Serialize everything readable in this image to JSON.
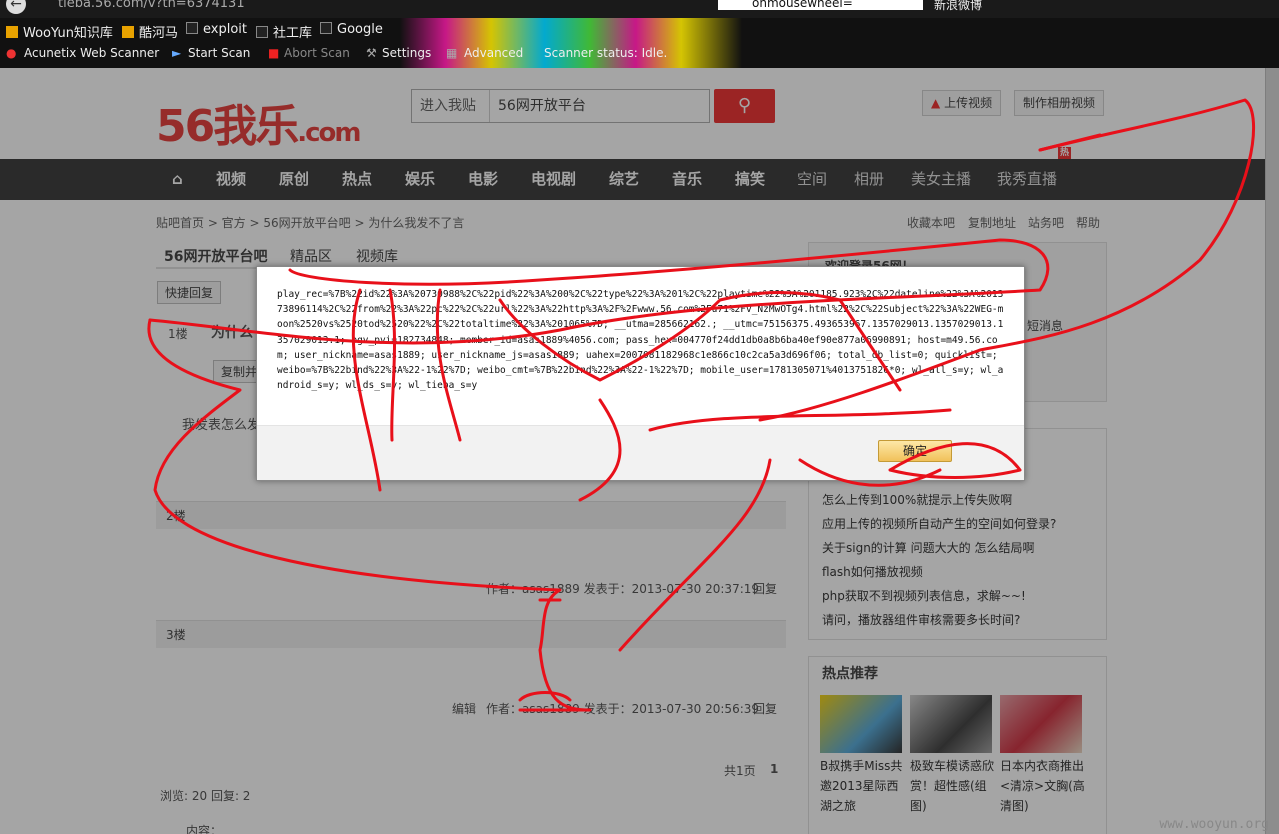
{
  "browser": {
    "url": "tieba.56.com/v?th=6374131",
    "search_value": "onmousewheel=",
    "weibo_label": "新浪微博",
    "bookmarks": [
      "WooYun知识库",
      "酷河马",
      "exploit",
      "社工库",
      "Google"
    ],
    "toolbar": {
      "acunetix": "Acunetix Web Scanner",
      "start_scan": "Start Scan",
      "abort_scan": "Abort Scan",
      "settings": "Settings",
      "advanced": "Advanced",
      "status": "Scanner status: Idle."
    }
  },
  "header": {
    "logo_num": "56",
    "logo_text": "我乐",
    "logo_domain": ".com",
    "search_select": "进入我贴",
    "search_value": "56网开放平台",
    "upload_btn": "上传视频",
    "album_btn": "制作相册视频"
  },
  "nav": {
    "items": [
      "视频",
      "原创",
      "热点",
      "娱乐",
      "电影",
      "电视剧",
      "综艺",
      "音乐",
      "搞笑"
    ],
    "items_light": [
      "空间",
      "相册",
      "美女主播",
      "我秀直播"
    ],
    "hot_badge": "热"
  },
  "breadcrumb": {
    "path": "贴吧首页 > 官方 > 56网开放平台吧 > 为什么我发不了言",
    "links": [
      "收藏本吧",
      "复制地址",
      "站务吧",
      "帮助"
    ]
  },
  "forum": {
    "tabs": [
      "56网开放平台吧",
      "精品区",
      "视频库"
    ],
    "quick_reply": "快捷回复",
    "floor1": "1楼",
    "title": "为什么",
    "copy_btn": "复制并",
    "post_text": "我发表怎么发",
    "floor2": "2楼",
    "floor2_meta": "作者：asas1889  发表于：2013-07-30 20:37:19",
    "reply": "回复",
    "floor3": "3楼",
    "edit": "编辑",
    "floor3_meta": "作者：asas1889  发表于：2013-07-30 20:56:39",
    "pages": "共1页",
    "page_num": "1",
    "stats": "浏览: 20 回复: 2",
    "content_label": "内容："
  },
  "sidebar": {
    "welcome": "欢迎登录56网！",
    "msg": "短消息",
    "questions": [
      "怎么上传到100%就提示上传失败啊",
      "应用上传的视频所自动产生的空间如何登录?",
      "关于sign的计算 问题大大的 怎么结局啊",
      "flash如何播放视频",
      "php获取不到视频列表信息，求解~~!",
      "请问，播放器组件审核需要多长时间?"
    ],
    "hot_title": "热点推荐",
    "hot_items": [
      "B叔携手Miss共邀2013星际西湖之旅",
      "极致车模诱惑欣赏！超性感(组图)",
      "日本内衣商推出<清凉>文胸(高清图)"
    ]
  },
  "dialog": {
    "content": "play_rec=%7B%22id%22%3A%20730988%2C%22pid%22%3A%200%2C%22type%22%3A%201%2C%22playtime%22%3A%201185.923%2C%22dateline%22%3A%201373896114%2C%22from%22%3A%22pc%22%2C%22url%22%3A%22http%3A%2F%2Fwww.56.com%2Fu71%2Fv_NzMwOTg4.html%22%2C%22Subject%22%3A%22WEG-moon%2520vs%2520tod%2520%22%2C%22totaltime%22%3A%201065%7D; __utma=285662162.; __utmc=75156375.493653967.1357029013.1357029013.1357029013.1; pgv_pvi=182734848; member_id=asas1889%4056.com; pass_hex=004770f24dd1db0a8b6ba40ef90e877a06990891; host=m49.56.com; user_nickname=asas1889; user_nickname_js=asas1889; uahex=2007081182968c1e866c10c2ca5a3d696f06; total_db_list=0; quicklist=; weibo=%7B%22bind%22%3A%22-1%22%7D; weibo_cmt=%7B%22bind%22%3A%22-1%22%7D; mobile_user=1781305071%4013751826*0; wl_all_s=y; wl_android_s=y; wl_ds_s=y; wl_tieba_s=y",
    "ok": "确定"
  },
  "watermark": "www.wooyun.org"
}
